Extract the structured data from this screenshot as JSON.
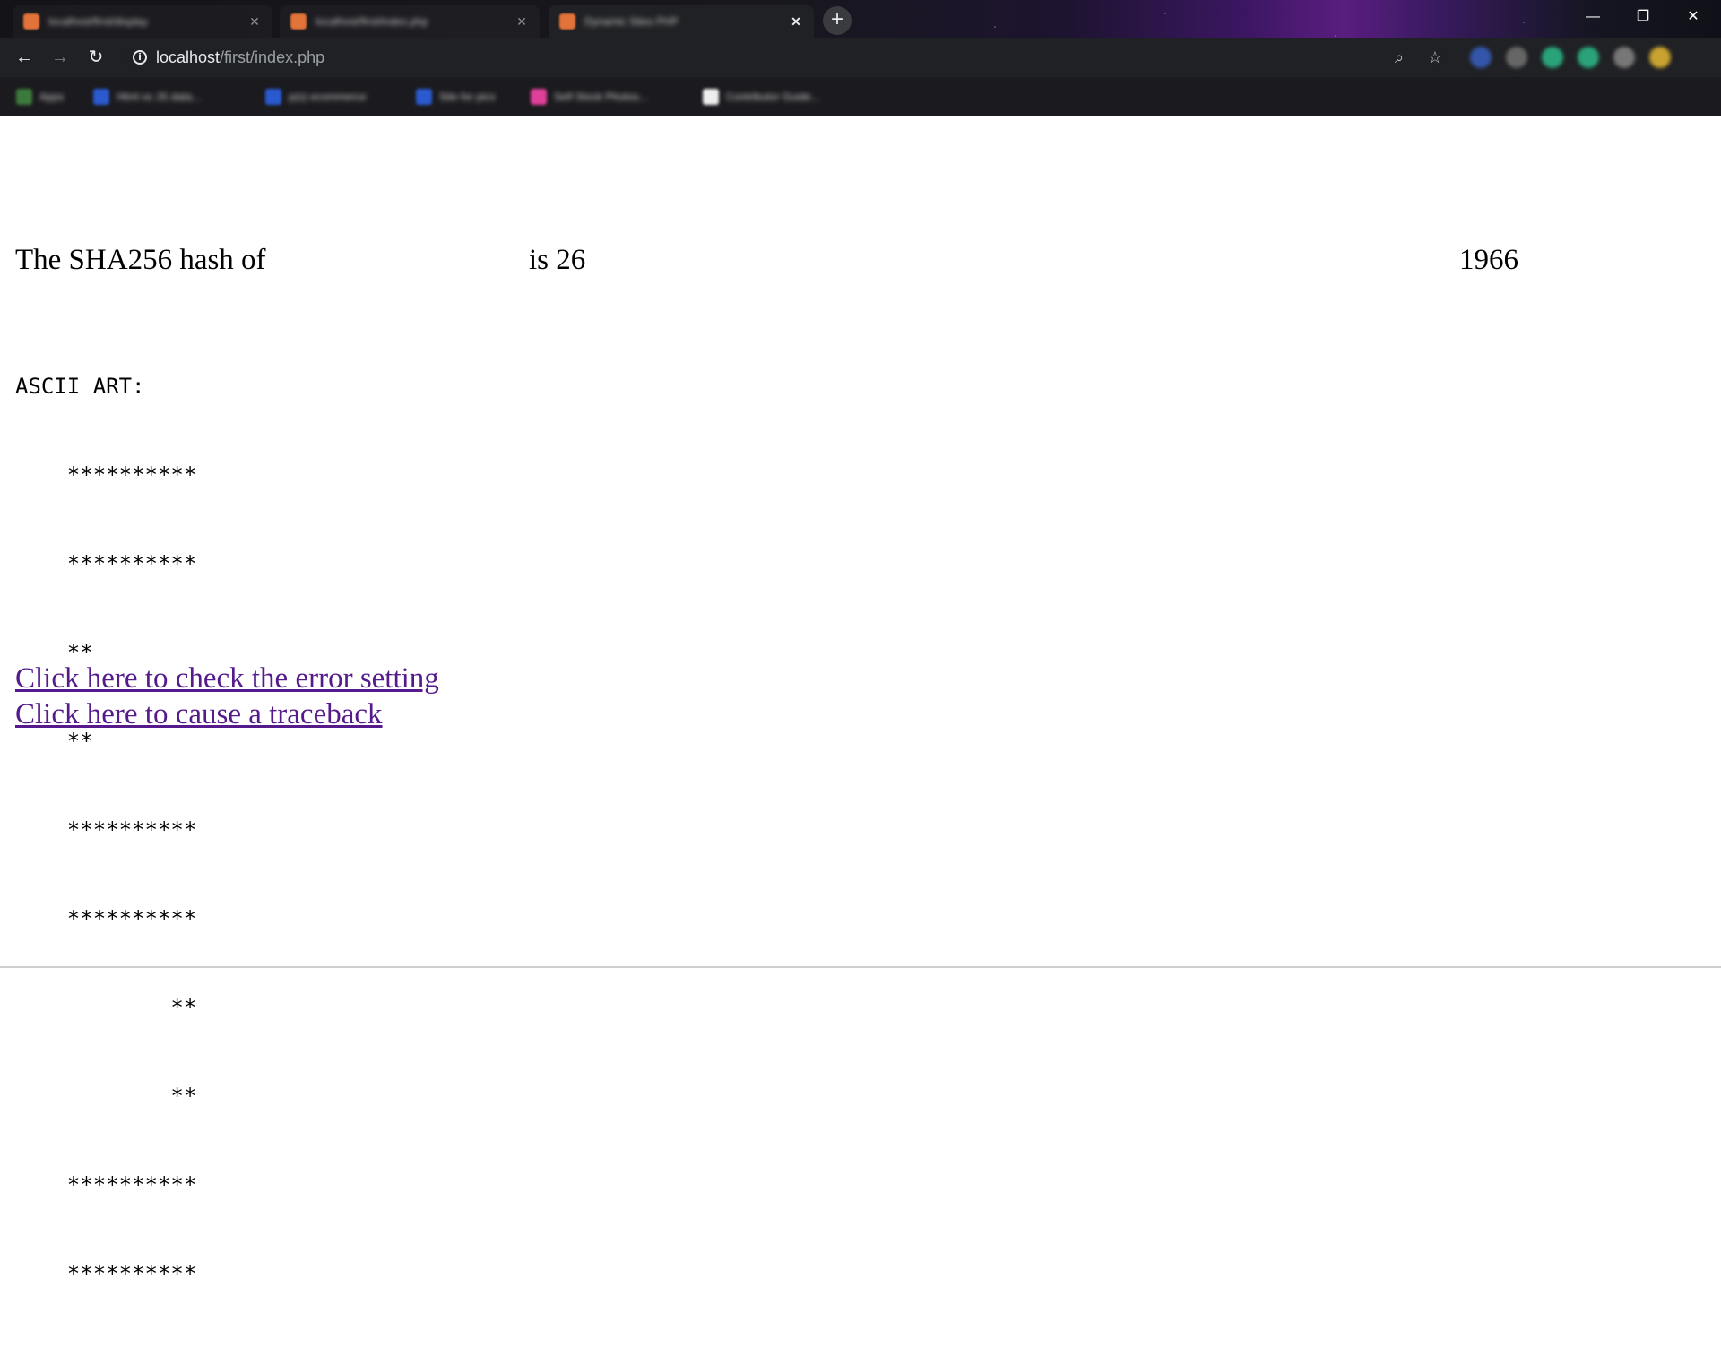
{
  "browser": {
    "tabs": [
      {
        "title": "localhost/first/display",
        "active": false
      },
      {
        "title": "localhost/first/index.php",
        "active": false
      },
      {
        "title": "Dynamic Sites PHP",
        "active": true
      }
    ],
    "new_tab_label": "+",
    "window_controls": {
      "minimize": "—",
      "restore": "❐",
      "close": "✕"
    },
    "nav": {
      "back": "←",
      "forward": "→",
      "reload": "↻"
    },
    "address": {
      "host": "localhost",
      "path": "/first/index.php"
    },
    "omnibox_icons": {
      "zoom": "⌕",
      "bookmark": "☆"
    },
    "bookmarks": [
      {
        "label": "Apps",
        "color": "#3c7a3c"
      },
      {
        "label": "Html vs JS data...",
        "color": "#2a5ad0"
      },
      {
        "label": "p(s) ecommerce",
        "color": "#2a5ad0"
      },
      {
        "label": "Site for pics",
        "color": "#2a5ad0"
      },
      {
        "label": "Self Stock Photos...",
        "color": "#e0409a"
      },
      {
        "label": "Contributor Guide...",
        "color": "#eeeeee"
      }
    ],
    "extensions": [
      "#3355aa",
      "#666666",
      "#2aa37a",
      "#2aa37a",
      "#777777",
      "#c9a230"
    ]
  },
  "page": {
    "hash_prefix": "The SHA256 hash of",
    "hash_mid": "is 26",
    "hash_end": "1966",
    "ascii_title": "ASCII ART:",
    "ascii_rows": [
      "    **********",
      "    **********",
      "    **",
      "    **",
      "    **********",
      "    **********",
      "            **",
      "            **",
      "    **********",
      "    **********"
    ],
    "link_error": "Click here to check the error setting",
    "link_traceback": "Click here to cause a traceback",
    "link_color": "#551a8b"
  }
}
